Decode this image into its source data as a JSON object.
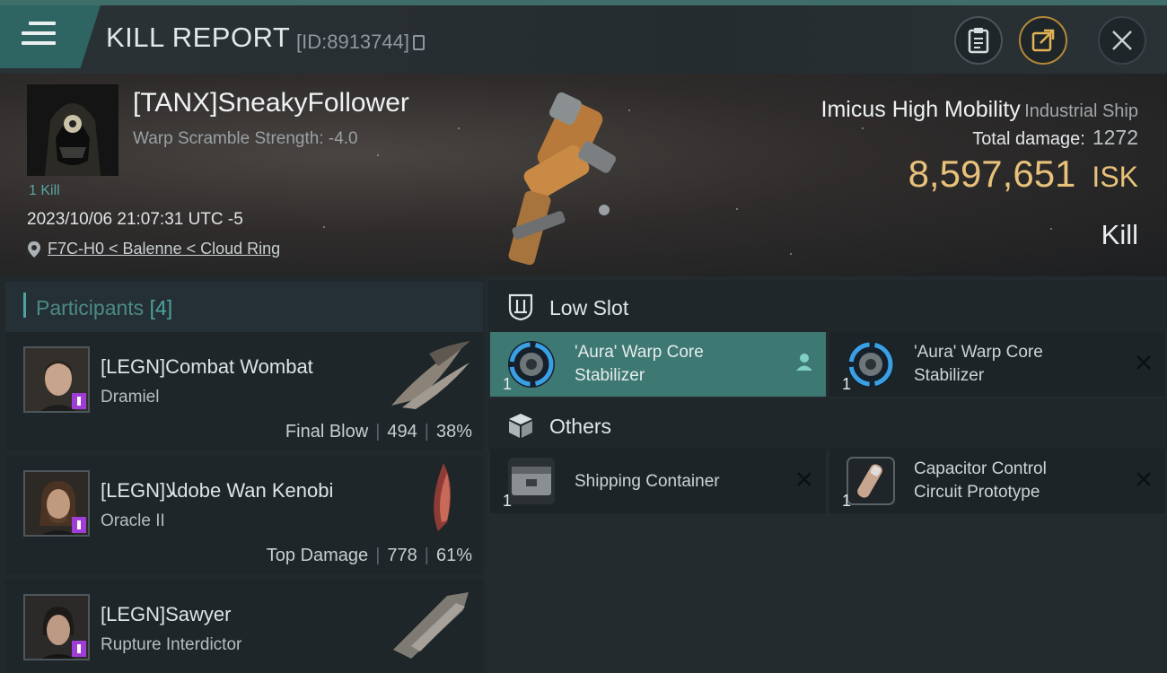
{
  "header": {
    "title": "KILL REPORT",
    "report_id": "[ID:8913744]"
  },
  "victim": {
    "name": "[TANX]SneakyFollower",
    "warp_scramble": "Warp Scramble Strength: -4.0",
    "kills": "1 Kill",
    "datetime": "2023/10/06 21:07:31 UTC -5",
    "location": "F7C-H0 < Balenne < Cloud Ring",
    "ship_name": "Imicus High Mobility",
    "ship_class": "Industrial Ship",
    "total_damage_label": "Total damage:",
    "total_damage": "1272",
    "isk_value": "8,597,651",
    "isk_unit": "ISK",
    "status": "Kill"
  },
  "participants": {
    "title": "Participants",
    "count": "[4]",
    "items": [
      {
        "name": "[LEGN]Combat Wombat",
        "ship": "Dramiel",
        "role": "Final Blow",
        "damage": "494",
        "percent": "38%"
      },
      {
        "name": "[LEGN]ﻼdobe Wan Kenobi",
        "ship": "Oracle II",
        "role": "Top Damage",
        "damage": "778",
        "percent": "61%"
      },
      {
        "name": "[LEGN]Sawyer",
        "ship": "Rupture Interdictor"
      }
    ]
  },
  "fittings": {
    "low_slot": {
      "label": "Low Slot",
      "items": [
        {
          "name_line1": "'Aura' Warp Core",
          "name_line2": "Stabilizer",
          "qty": "1"
        },
        {
          "name_line1": "'Aura' Warp Core",
          "name_line2": "Stabilizer",
          "qty": "1"
        }
      ]
    },
    "others": {
      "label": "Others",
      "items": [
        {
          "name_line1": "Shipping Container",
          "qty": "1"
        },
        {
          "name_line1": "Capacitor Control",
          "name_line2": "Circuit Prototype",
          "qty": "1"
        }
      ]
    }
  },
  "colors": {
    "accent": "#3e7873",
    "isk": "#e8c17a",
    "badge": "#a03cd8"
  }
}
